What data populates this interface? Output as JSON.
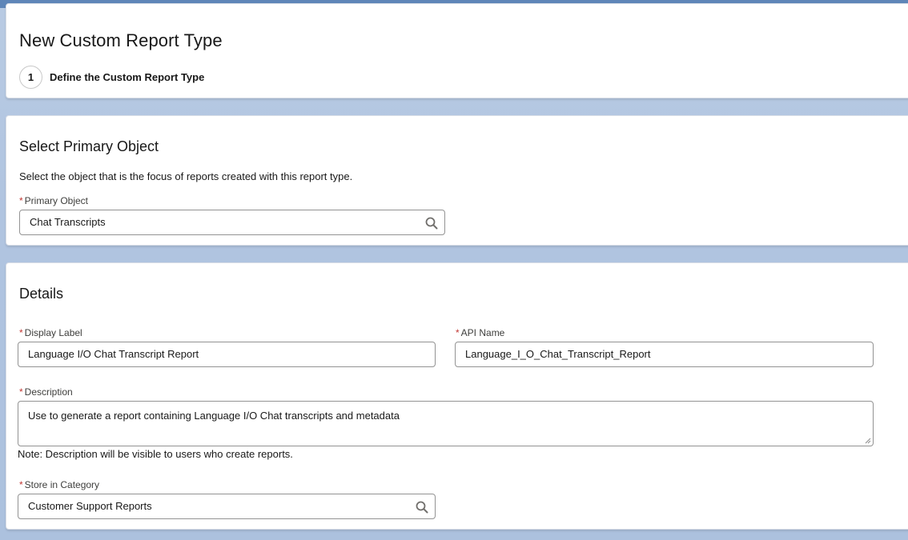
{
  "header": {
    "title": "New Custom Report Type",
    "step_number": "1",
    "step_label": "Define the Custom Report Type"
  },
  "primary_object_section": {
    "title": "Select Primary Object",
    "help_text": "Select the object that is the focus of reports created with this report type.",
    "field_label": "Primary Object",
    "value": "Chat Transcripts",
    "icon": "search-icon"
  },
  "details_section": {
    "title": "Details",
    "display_label": {
      "label": "Display Label",
      "value": "Language I/O Chat Transcript Report"
    },
    "api_name": {
      "label": "API Name",
      "value": "Language_I_O_Chat_Transcript_Report"
    },
    "description": {
      "label": "Description",
      "value": "Use to generate a report containing Language I/O Chat transcripts and metadata",
      "note": "Note: Description will be visible to users who create reports."
    },
    "category": {
      "label": "Store in Category",
      "value": "Customer Support Reports",
      "icon": "search-icon"
    }
  },
  "required_marker": "*",
  "colors": {
    "required": "#c23934",
    "background": "#b0c4e0",
    "card": "#ffffff",
    "border": "#939393"
  }
}
